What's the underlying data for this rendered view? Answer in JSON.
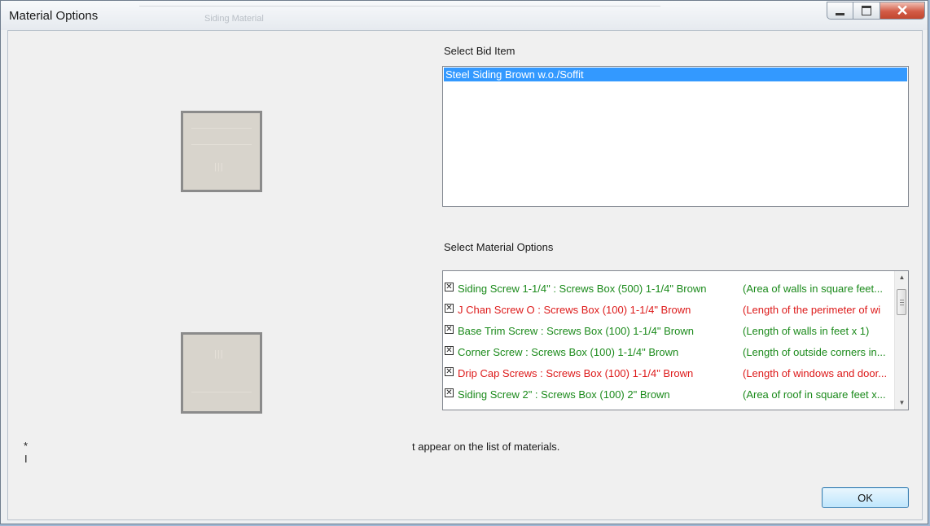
{
  "window": {
    "title": "Material Options",
    "background_title": "Siding Material",
    "controls": {
      "minimize": "minimize",
      "maximize": "maximize",
      "close": "✕"
    }
  },
  "bid_section": {
    "label": "Select Bid Item",
    "items": [
      {
        "text": "Steel Siding Brown w.o./Soffit",
        "selected": true
      }
    ]
  },
  "material_section": {
    "label": "Select Material Options",
    "options": [
      {
        "name": "Siding Screw 1-1/4\" : Screws Box (500) 1-1/4\" Brown",
        "desc": "(Area of walls in square feet...",
        "color": "green",
        "checked": true
      },
      {
        "name": "J Chan Screw O : Screws Box (100) 1-1/4\" Brown",
        "desc": "(Length of the perimeter of wi",
        "color": "red",
        "checked": true
      },
      {
        "name": "Base Trim Screw : Screws Box (100) 1-1/4\" Brown",
        "desc": "(Length of walls in feet x 1)",
        "color": "green",
        "checked": true
      },
      {
        "name": "Corner Screw : Screws Box (100) 1-1/4\" Brown",
        "desc": "(Length of outside corners in...",
        "color": "green",
        "checked": true
      },
      {
        "name": "Drip Cap Screws : Screws Box (100) 1-1/4\" Brown",
        "desc": "(Length of windows and door...",
        "color": "red",
        "checked": true
      },
      {
        "name": "Siding Screw 2\" : Screws Box (100) 2\" Brown",
        "desc": "(Area of roof in square feet x...",
        "color": "green",
        "checked": true
      }
    ]
  },
  "notes": {
    "asterisk": "*",
    "line2": "I",
    "fragment": "t appear on the list of materials."
  },
  "buttons": {
    "ok": "OK"
  },
  "colors": {
    "green": "#1b8a1b",
    "red": "#dd1a1a",
    "selection": "#3399ff"
  }
}
